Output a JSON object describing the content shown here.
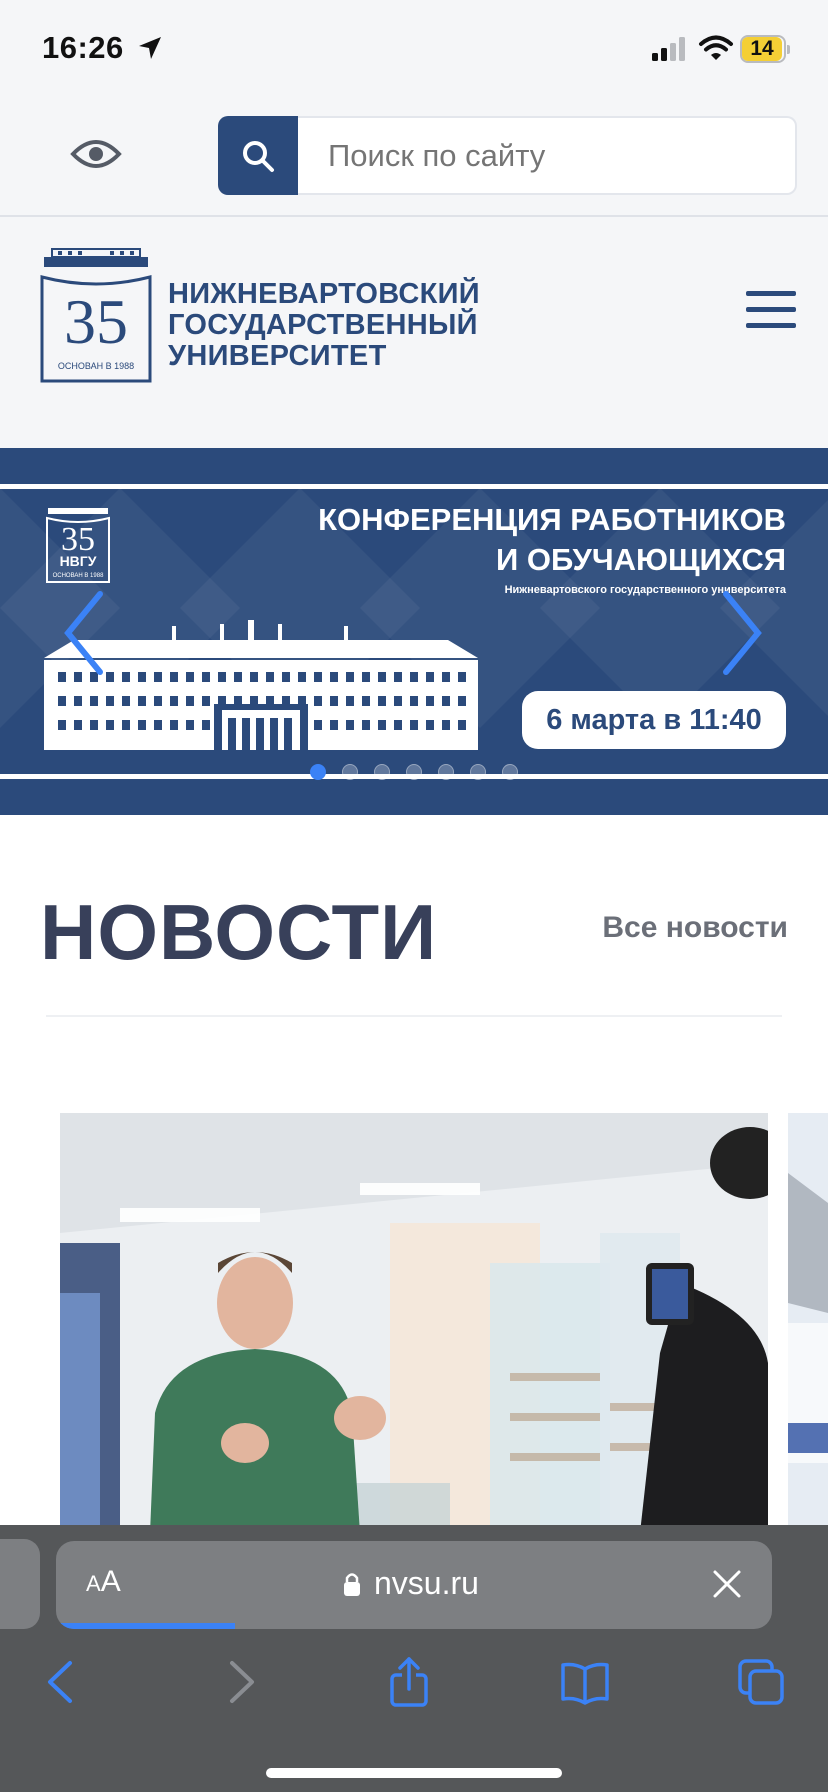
{
  "status_bar": {
    "time": "16:26",
    "battery": "14"
  },
  "search": {
    "placeholder": "Поиск по сайту"
  },
  "header": {
    "logo_number": "35",
    "logo_caption": "ОСНОВАН В 1988",
    "name_line1": "НИЖНЕВАРТОВСКИЙ",
    "name_line2": "ГОСУДАРСТВЕННЫЙ",
    "name_line3": "УНИВЕРСИТЕТ"
  },
  "banner": {
    "logo_number": "35",
    "logo_abbr": "НВГУ",
    "logo_caption": "ОСНОВАН В 1988",
    "title_line1": "КОНФЕРЕНЦИЯ РАБОТНИКОВ",
    "title_line2": "И ОБУЧАЮЩИХСЯ",
    "subtitle": "Нижневартовского государственного университета",
    "date": "6 марта в 11:40",
    "slide_count": 7,
    "active_slide": 1
  },
  "news": {
    "title": "НОВОСТИ",
    "all_link": "Все новости"
  },
  "browser": {
    "text_size_small": "A",
    "text_size_large": "A",
    "url": "nvsu.ru",
    "load_progress": 0.25
  },
  "colors": {
    "brand": "#2b4a7b",
    "accent": "#3b82f6"
  }
}
